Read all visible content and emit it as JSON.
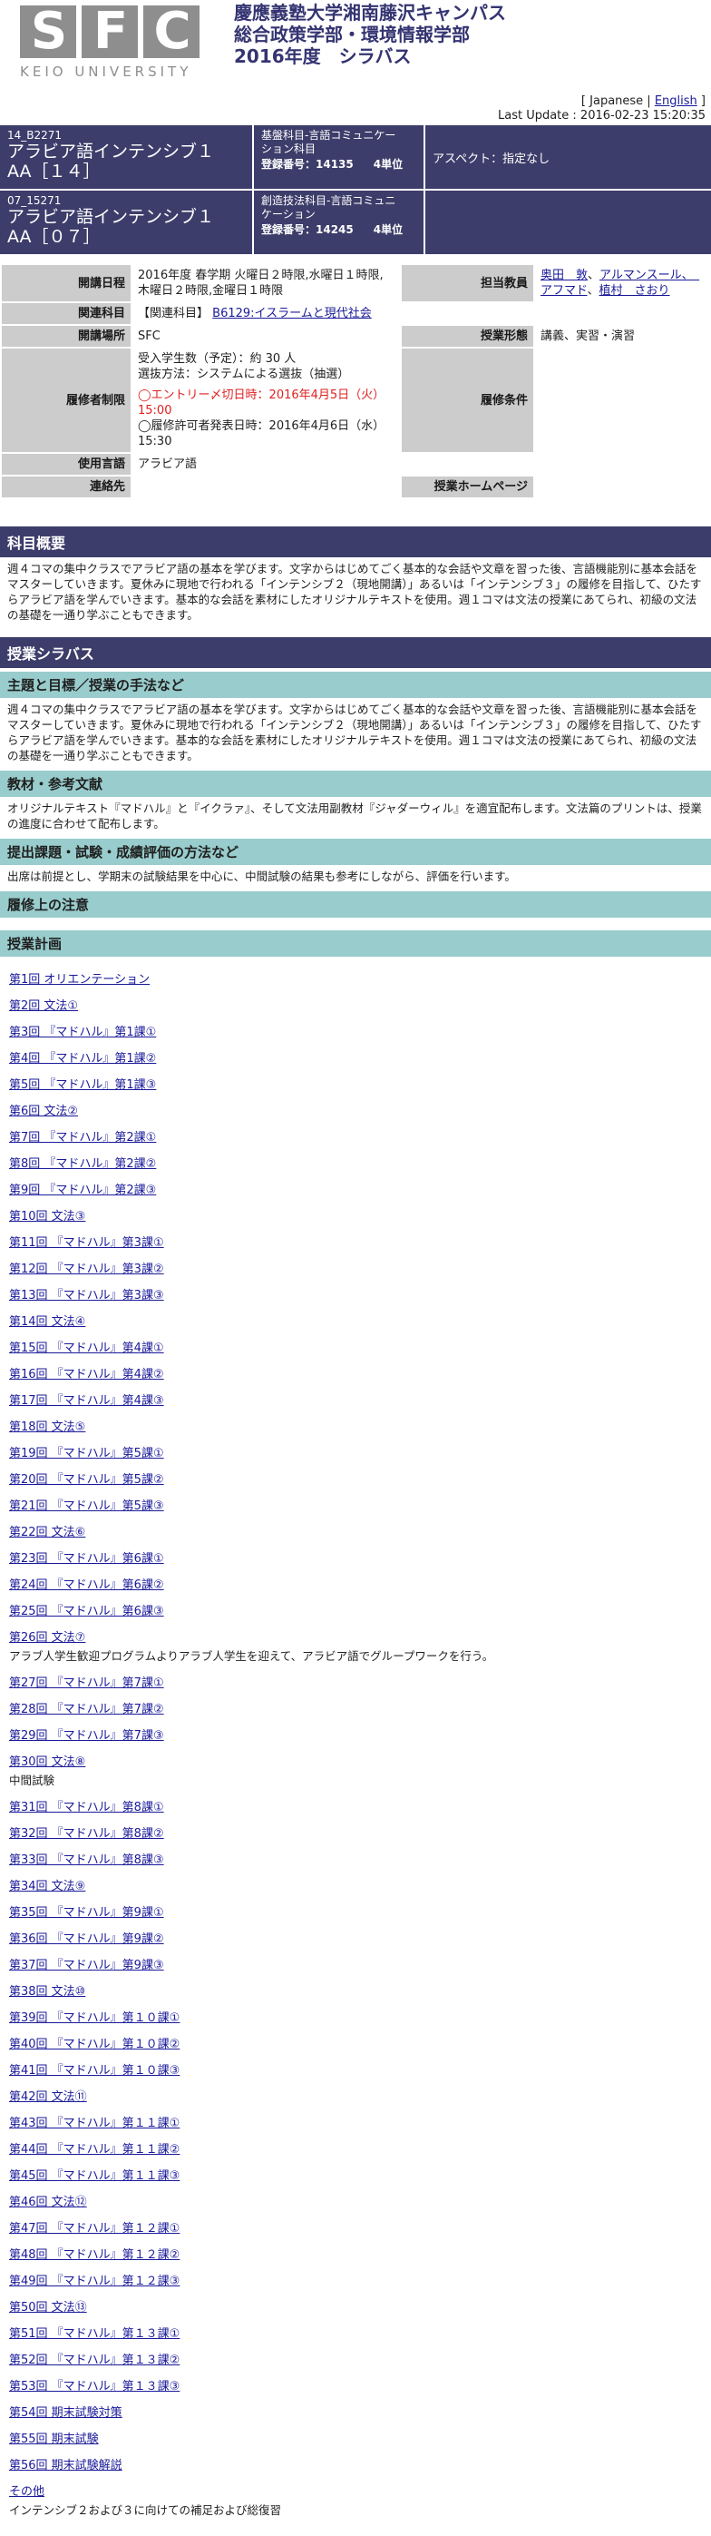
{
  "header": {
    "logo_letters": [
      "S",
      "F",
      "C"
    ],
    "logo_sub": "KEIO UNIVERSITY",
    "title_line1": "慶應義塾大学湘南藤沢キャンパス",
    "title_line2": "総合政策学部・環境情報学部",
    "title_line3": "2016年度　シラバス",
    "lang_open": "[ ",
    "lang_japanese": "Japanese",
    "lang_sep": " | ",
    "lang_english": "English",
    "lang_close": " ]",
    "last_update": "Last Update : 2016-02-23 15:20:35"
  },
  "courses": [
    {
      "code": "14_B2271",
      "name_line1": "アラビア語インテンシブ１",
      "name_line2": "AA［１４］",
      "category_line1": "基盤科目-言語コミュニケー",
      "category_line2": "ション科目",
      "reg_label": "登録番号：14135",
      "units": "4単位",
      "aspect": "アスペクト：指定なし"
    },
    {
      "code": "07_15271",
      "name_line1": "アラビア語インテンシブ１",
      "name_line2": "AA［０７］",
      "category_line1": "創造技法科目-言語コミュニ",
      "category_line2": "ケーション",
      "reg_label": "登録番号：14245",
      "units": "4単位",
      "aspect": ""
    }
  ],
  "info": {
    "schedule_label": "開講日程",
    "schedule_value": "2016年度 春学期 火曜日２時限,水曜日１時限,木曜日２時限,金曜日１時限",
    "instructor_label": "担当教員",
    "instructors": [
      "奥田　敦",
      "アルマンスール、　アフマド",
      "植村　さおり"
    ],
    "related_label": "関連科目",
    "related_prefix": "【関連科目】",
    "related_link": "B6129:イスラームと現代社会",
    "location_label": "開講場所",
    "location_value": "SFC",
    "format_label": "授業形態",
    "format_value": "講義、実習・演習",
    "restriction_label": "履修者制限",
    "restriction_line1": "受入学生数（予定）：約 30 人",
    "restriction_line2": "選抜方法：システムによる選抜（抽選）",
    "restriction_entry": "◯エントリー〆切日時：2016年4月5日（火）15:00",
    "restriction_announce": "◯履修許可者発表日時：2016年4月6日（水）15:30",
    "conditions_label": "履修条件",
    "conditions_value": "",
    "language_label": "使用言語",
    "language_value": "アラビア語",
    "contact_label": "連絡先",
    "contact_value": "",
    "homepage_label": "授業ホームページ",
    "homepage_value": ""
  },
  "overview": {
    "heading": "科目概要",
    "text": "週４コマの集中クラスでアラビア語の基本を学びます。文字からはじめてごく基本的な会話や文章を習った後、言語機能別に基本会話をマスターしていきます。夏休みに現地で行われる「インテンシブ２（現地開講）」あるいは「インテンシブ３」の履修を目指して、ひたすらアラビア語を学んでいきます。基本的な会話を素材にしたオリジナルテキストを使用。週１コマは文法の授業にあてられ、初級の文法の基礎を一通り学ぶこともできます。"
  },
  "syllabus": {
    "heading": "授業シラバス",
    "goals_heading": "主題と目標／授業の手法など",
    "goals_text": "週４コマの集中クラスでアラビア語の基本を学びます。文字からはじめてごく基本的な会話や文章を習った後、言語機能別に基本会話をマスターしていきます。夏休みに現地で行われる「インテンシブ２（現地開講）」あるいは「インテンシブ３」の履修を目指して、ひたすらアラビア語を学んでいきます。基本的な会話を素材にしたオリジナルテキストを使用。週１コマは文法の授業にあてられ、初級の文法の基礎を一通り学ぶこともできます。",
    "materials_heading": "教材・参考文献",
    "materials_text": "オリジナルテキスト『マドハル』と『イクラァ』、そして文法用副教材『ジャダーウィル』を適宜配布します。文法篇のプリントは、授業の進度に合わせて配布します。",
    "evaluation_heading": "提出課題・試験・成績評価の方法など",
    "evaluation_text": "出席は前提とし、学期末の試験結果を中心に、中間試験の結果も参考にしながら、評価を行います。",
    "notes_heading": "履修上の注意",
    "plan_heading": "授業計画"
  },
  "schedule": [
    {
      "label": "第1回 オリエンテーション",
      "note": ""
    },
    {
      "label": "第2回 文法①",
      "note": ""
    },
    {
      "label": "第3回 『マドハル』第1課①",
      "note": ""
    },
    {
      "label": "第4回 『マドハル』第1課②",
      "note": ""
    },
    {
      "label": "第5回 『マドハル』第1課③",
      "note": ""
    },
    {
      "label": "第6回 文法②",
      "note": ""
    },
    {
      "label": "第7回 『マドハル』第2課①",
      "note": ""
    },
    {
      "label": "第8回 『マドハル』第2課②",
      "note": ""
    },
    {
      "label": "第9回 『マドハル』第2課③",
      "note": ""
    },
    {
      "label": "第10回 文法③",
      "note": ""
    },
    {
      "label": "第11回 『マドハル』第3課①",
      "note": ""
    },
    {
      "label": "第12回 『マドハル』第3課②",
      "note": ""
    },
    {
      "label": "第13回 『マドハル』第3課③",
      "note": ""
    },
    {
      "label": "第14回 文法④",
      "note": ""
    },
    {
      "label": "第15回 『マドハル』第4課①",
      "note": ""
    },
    {
      "label": "第16回 『マドハル』第4課②",
      "note": ""
    },
    {
      "label": "第17回 『マドハル』第4課③",
      "note": ""
    },
    {
      "label": "第18回 文法⑤",
      "note": ""
    },
    {
      "label": "第19回 『マドハル』第5課①",
      "note": ""
    },
    {
      "label": "第20回 『マドハル』第5課②",
      "note": ""
    },
    {
      "label": "第21回 『マドハル』第5課③",
      "note": ""
    },
    {
      "label": "第22回 文法⑥",
      "note": ""
    },
    {
      "label": "第23回 『マドハル』第6課①",
      "note": ""
    },
    {
      "label": "第24回 『マドハル』第6課②",
      "note": ""
    },
    {
      "label": "第25回 『マドハル』第6課③",
      "note": ""
    },
    {
      "label": "第26回 文法⑦",
      "note": "アラブ人学生歓迎プログラムよりアラブ人学生を迎えて、アラビア語でグループワークを行う。"
    },
    {
      "label": "第27回 『マドハル』第7課①",
      "note": ""
    },
    {
      "label": "第28回 『マドハル』第7課②",
      "note": ""
    },
    {
      "label": "第29回 『マドハル』第7課③",
      "note": ""
    },
    {
      "label": "第30回 文法⑧",
      "note": "中間試験"
    },
    {
      "label": "第31回 『マドハル』第8課①",
      "note": ""
    },
    {
      "label": "第32回 『マドハル』第8課②",
      "note": ""
    },
    {
      "label": "第33回 『マドハル』第8課③",
      "note": ""
    },
    {
      "label": "第34回 文法⑨",
      "note": ""
    },
    {
      "label": "第35回 『マドハル』第9課①",
      "note": ""
    },
    {
      "label": "第36回 『マドハル』第9課②",
      "note": ""
    },
    {
      "label": "第37回 『マドハル』第9課③",
      "note": ""
    },
    {
      "label": "第38回 文法⑩",
      "note": ""
    },
    {
      "label": "第39回 『マドハル』第１０課①",
      "note": ""
    },
    {
      "label": "第40回 『マドハル』第１０課②",
      "note": ""
    },
    {
      "label": "第41回 『マドハル』第１０課③",
      "note": ""
    },
    {
      "label": "第42回 文法⑪",
      "note": ""
    },
    {
      "label": "第43回 『マドハル』第１１課①",
      "note": ""
    },
    {
      "label": "第44回 『マドハル』第１１課②",
      "note": ""
    },
    {
      "label": "第45回 『マドハル』第１１課③",
      "note": ""
    },
    {
      "label": "第46回 文法⑫",
      "note": ""
    },
    {
      "label": "第47回 『マドハル』第１２課①",
      "note": ""
    },
    {
      "label": "第48回 『マドハル』第１２課②",
      "note": ""
    },
    {
      "label": "第49回 『マドハル』第１２課③",
      "note": ""
    },
    {
      "label": "第50回 文法⑬",
      "note": ""
    },
    {
      "label": "第51回 『マドハル』第１３課①",
      "note": ""
    },
    {
      "label": "第52回 『マドハル』第１３課②",
      "note": ""
    },
    {
      "label": "第53回 『マドハル』第１３課③",
      "note": ""
    },
    {
      "label": "第54回 期末試験対策",
      "note": ""
    },
    {
      "label": "第55回 期末試験",
      "note": ""
    },
    {
      "label": "第56回 期末試験解説",
      "note": ""
    },
    {
      "label": "その他",
      "note": "インテンシブ２および３に向けての補足および総復習"
    }
  ]
}
